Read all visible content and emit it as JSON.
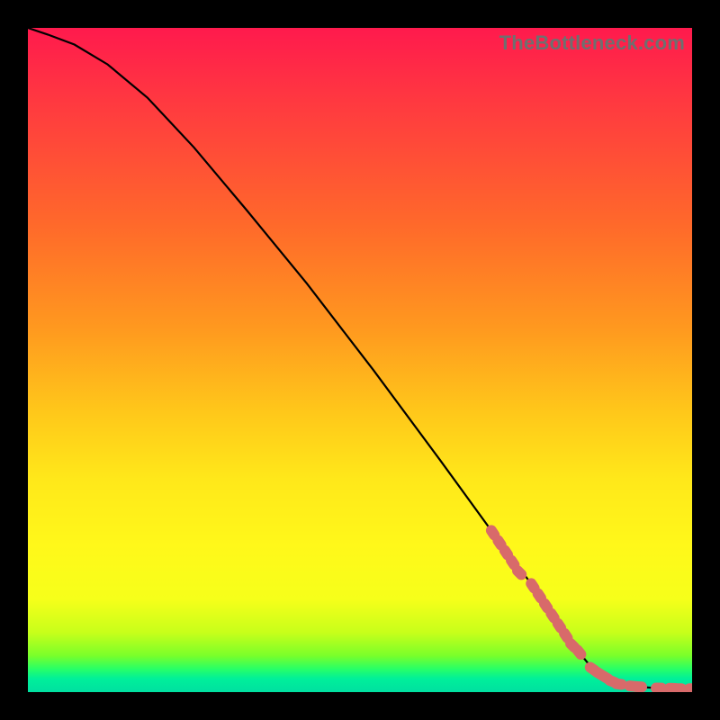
{
  "watermark": "TheBottleneck.com",
  "colors": {
    "marker": "#d86a6a",
    "curve": "#000000"
  },
  "chart_data": {
    "type": "line",
    "title": "",
    "xlabel": "",
    "ylabel": "",
    "xlim": [
      0,
      100
    ],
    "ylim": [
      0,
      100
    ],
    "grid": false,
    "legend": false,
    "series": [
      {
        "name": "curve",
        "x": [
          0,
          3,
          7,
          12,
          18,
          25,
          33,
          42,
          52,
          62,
          70,
          76,
          80,
          83,
          85,
          88,
          92,
          96,
          100
        ],
        "y": [
          100,
          99,
          97.5,
          94.5,
          89.5,
          82,
          72.5,
          61.5,
          48.5,
          35,
          24,
          16,
          10,
          6,
          3.5,
          1.5,
          0.8,
          0.5,
          0.5
        ]
      }
    ],
    "markers": {
      "name": "highlighted-points",
      "x": [
        70,
        71,
        72,
        73,
        74,
        76,
        77,
        78,
        79,
        80,
        81,
        82,
        83,
        85,
        86,
        87,
        88,
        89,
        91,
        92,
        95,
        97,
        98,
        100
      ],
      "y": [
        24,
        22.5,
        21,
        19.5,
        18,
        16,
        14.5,
        13,
        11.5,
        10,
        8.5,
        7,
        6,
        3.5,
        2.8,
        2.2,
        1.6,
        1.2,
        0.9,
        0.8,
        0.6,
        0.55,
        0.5,
        0.5
      ]
    }
  }
}
